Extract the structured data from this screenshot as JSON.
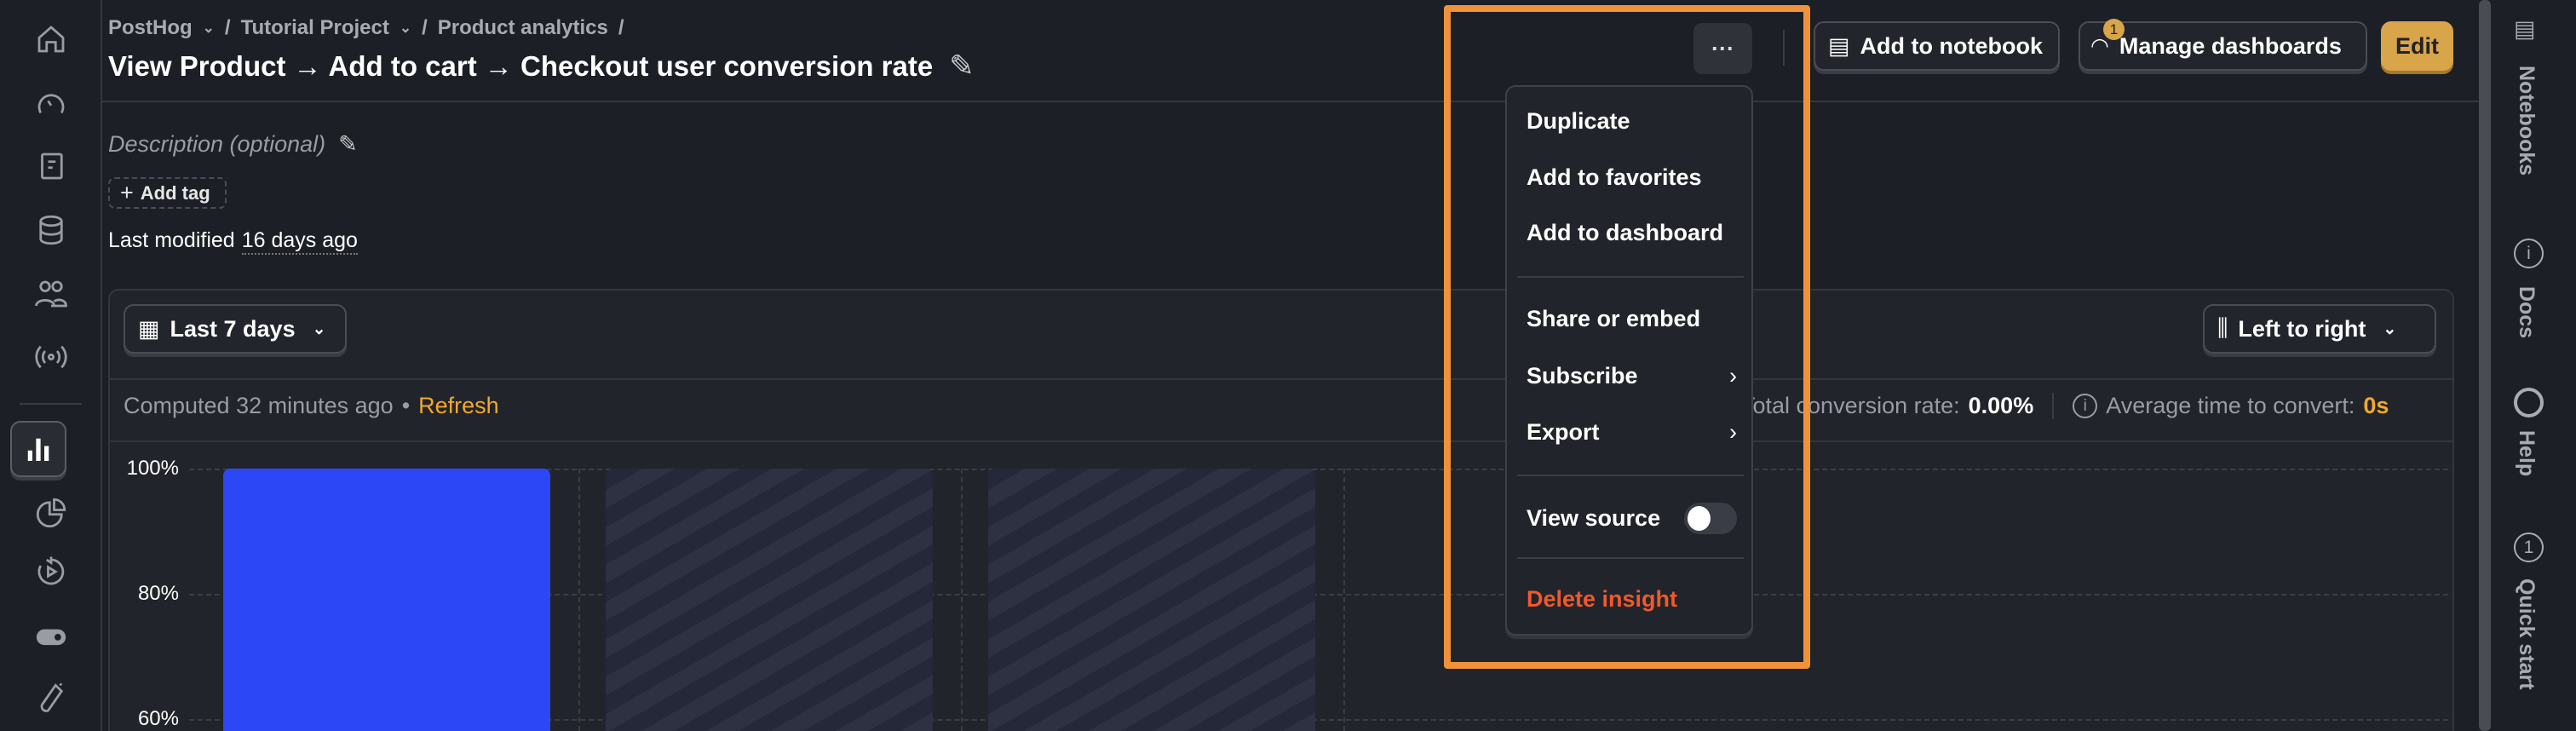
{
  "breadcrumb": [
    {
      "label": "PostHog"
    },
    {
      "label": "Tutorial Project"
    },
    {
      "label": "Product analytics"
    }
  ],
  "title": "View Product → Add to cart → Checkout user conversion rate",
  "description_placeholder": "Description (optional)",
  "add_tag": "Add tag",
  "last_modified_label": "Last modified",
  "last_modified_value": "16 days ago",
  "toolbar": {
    "more_label": "···",
    "add_to_notebook": "Add to notebook",
    "manage_dashboards": "Manage dashboards",
    "manage_dashboards_badge": "1",
    "edit": "Edit"
  },
  "date_range": "Last 7 days",
  "layout_select": "Left to right",
  "computed": "Computed 32 minutes ago",
  "refresh": "Refresh",
  "total_conversion_label": "Total conversion rate:",
  "total_conversion_value": "0.00%",
  "avg_time_label": "Average time to convert:",
  "avg_time_value": "0s",
  "menu": {
    "duplicate": "Duplicate",
    "favorites": "Add to favorites",
    "dashboard": "Add to dashboard",
    "share": "Share or embed",
    "subscribe": "Subscribe",
    "export": "Export",
    "view_source": "View source",
    "view_source_on": false,
    "delete": "Delete insight"
  },
  "right_sidebar": [
    "Notebooks",
    "Docs",
    "Help",
    "Quick start"
  ],
  "colors": {
    "accent": "#f0923a",
    "edit": "#d9a54b",
    "bar": "#2c47f5",
    "refresh": "#f1a82c",
    "danger": "#f0592b"
  },
  "chart_data": {
    "type": "bar",
    "y_ticks": [
      "100%",
      "80%",
      "60%"
    ],
    "values": [
      100,
      0,
      0
    ],
    "ylim": [
      0,
      100
    ],
    "grid": true
  }
}
